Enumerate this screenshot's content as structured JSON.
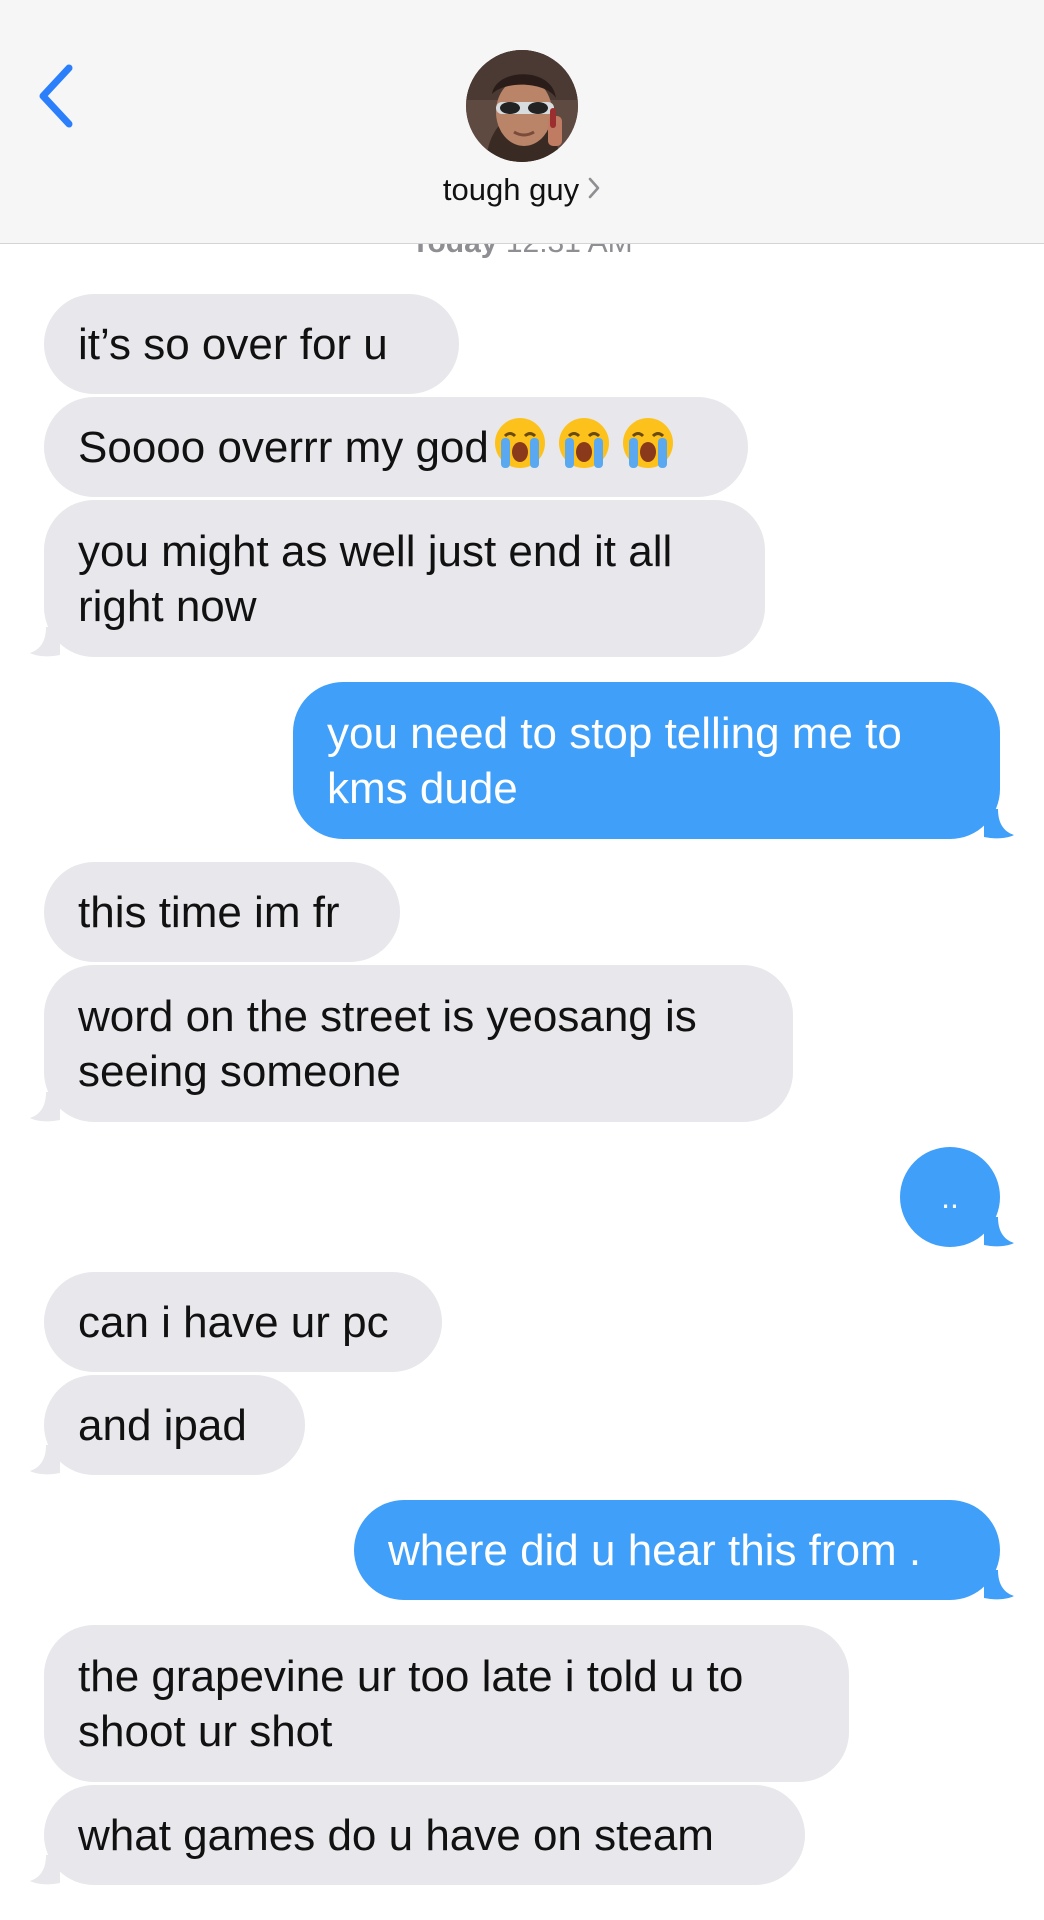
{
  "header": {
    "contact_name": "tough guy",
    "accent_color": "#2b7ffb"
  },
  "timestamp": {
    "day": "Today",
    "time": "12:31 AM"
  },
  "messages": [
    {
      "from": "them",
      "text": "it’s so over for u"
    },
    {
      "from": "them",
      "text": "Soooo overrr my god",
      "emojis": [
        "crying-face",
        "crying-face",
        "crying-face"
      ]
    },
    {
      "from": "them",
      "text_lines": [
        "you might as well just end it all",
        "right now"
      ]
    },
    {
      "from": "me",
      "text_lines": [
        "you need to stop telling me to",
        "kms dude"
      ]
    },
    {
      "from": "them",
      "text": "this time im fr"
    },
    {
      "from": "them",
      "text_lines": [
        "word on the street is yeosang is",
        "seeing someone"
      ]
    },
    {
      "from": "me",
      "text": ".."
    },
    {
      "from": "them",
      "text": "can i have ur pc"
    },
    {
      "from": "them",
      "text": "and ipad"
    },
    {
      "from": "me",
      "text": "where did u hear this from ."
    },
    {
      "from": "them",
      "text_lines": [
        "the grapevine ur too late i told u to",
        "shoot ur shot"
      ]
    },
    {
      "from": "them",
      "text": "what games do u have on steam"
    }
  ],
  "colors": {
    "incoming_bubble": "#e7e7ec",
    "outgoing_bubble": "#3f9ff9",
    "header_bg": "#f6f6f6"
  }
}
